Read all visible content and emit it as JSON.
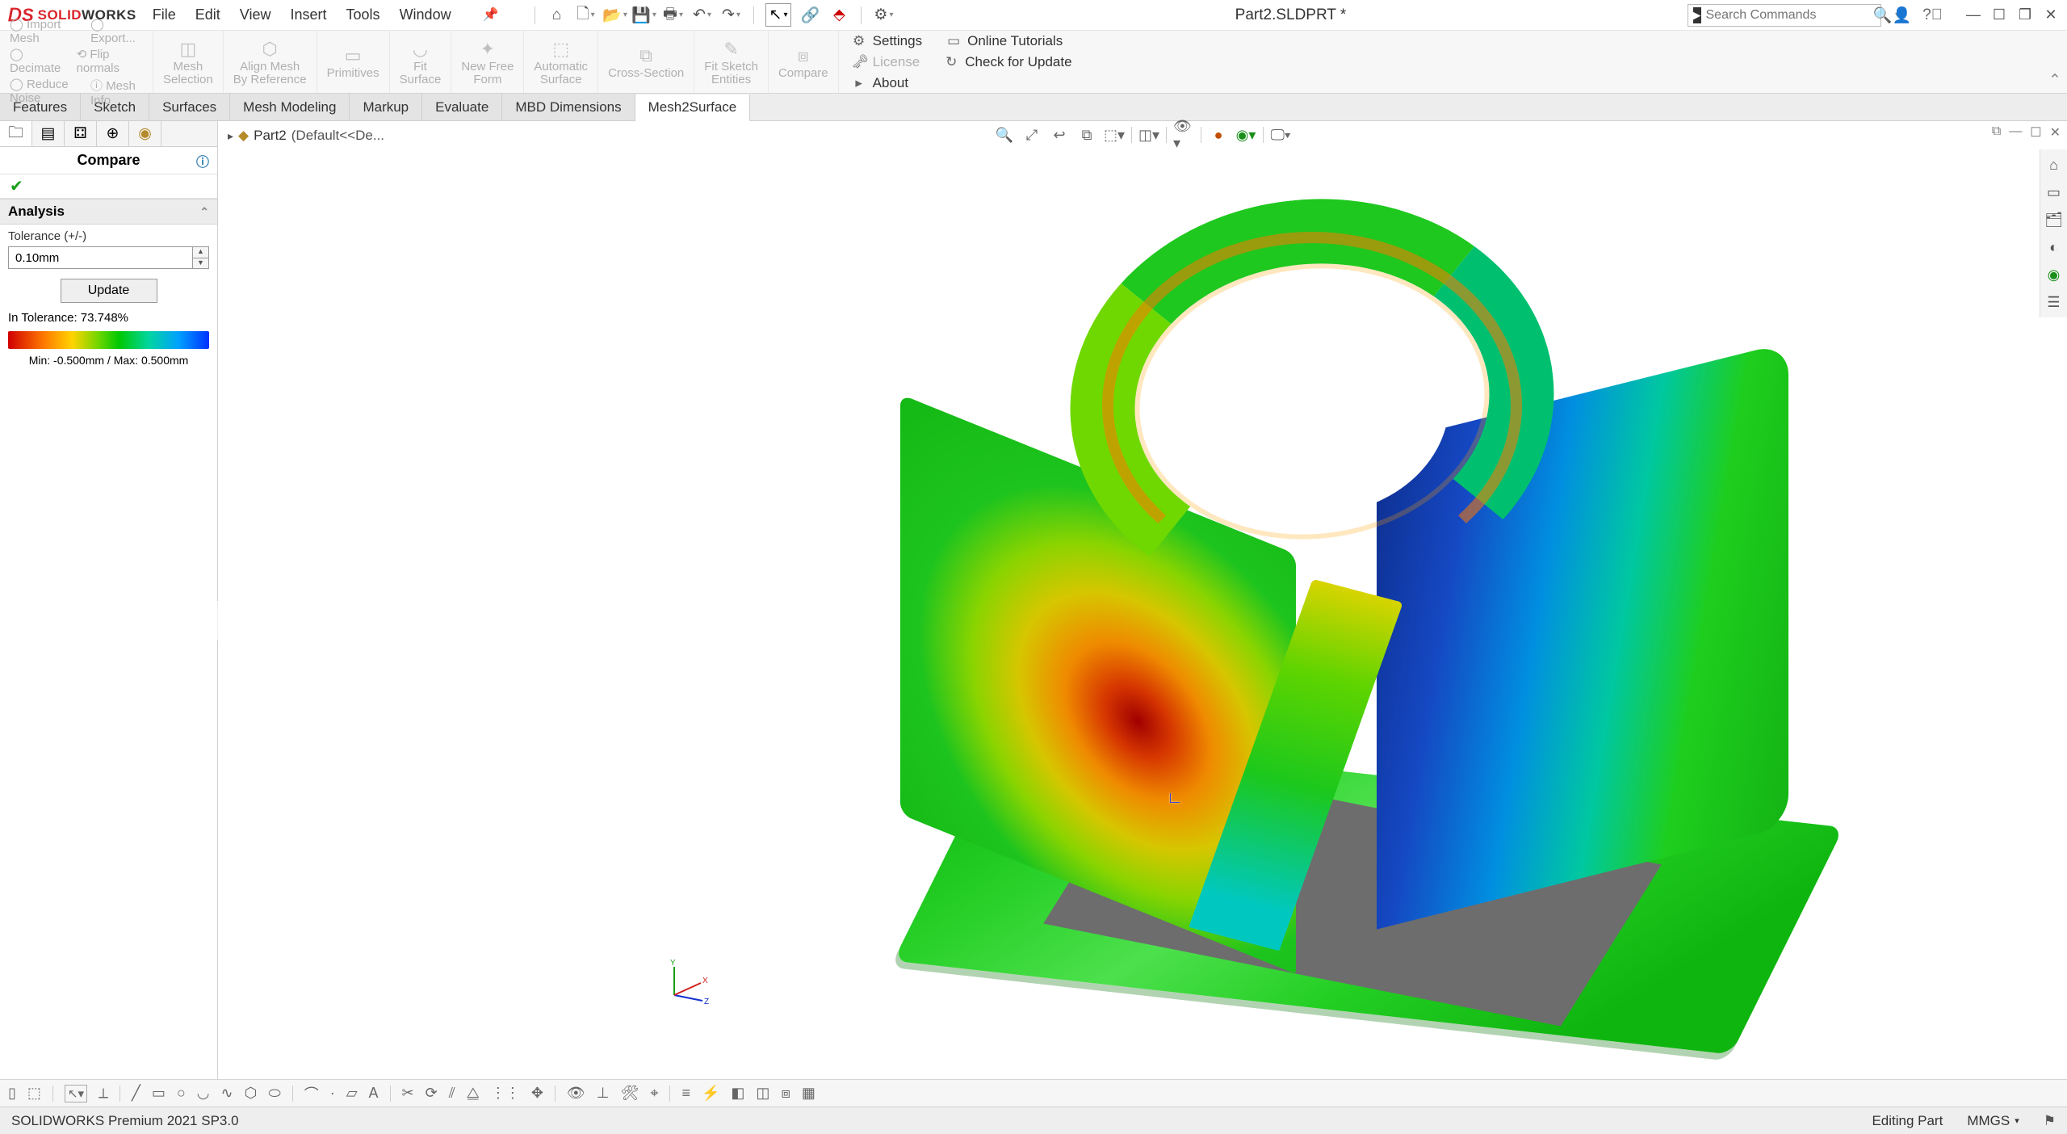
{
  "app": {
    "brand_prefix": "SOLID",
    "brand_suffix": "WORKS",
    "title": "Part2.SLDPRT *",
    "menus": [
      "File",
      "Edit",
      "View",
      "Insert",
      "Tools",
      "Window"
    ]
  },
  "search": {
    "placeholder": "Search Commands"
  },
  "ribbon": {
    "groups": [
      {
        "id": "import-mesh",
        "label": "Import Mesh"
      },
      {
        "id": "export",
        "label": "Export..."
      },
      {
        "id": "decimate",
        "label": "Decimate"
      },
      {
        "id": "flip-normals",
        "label": "Flip normals"
      },
      {
        "id": "reduce-noise",
        "label": "Reduce Noise"
      },
      {
        "id": "mesh-info",
        "label": "Mesh Info"
      },
      {
        "id": "mesh-selection",
        "label": "Mesh\nSelection"
      },
      {
        "id": "align-mesh",
        "label": "Align Mesh\nBy Reference"
      },
      {
        "id": "primitives",
        "label": "Primitives"
      },
      {
        "id": "fit-surface",
        "label": "Fit\nSurface"
      },
      {
        "id": "new-free-form",
        "label": "New Free\nForm"
      },
      {
        "id": "automatic-surface",
        "label": "Automatic\nSurface"
      },
      {
        "id": "cross-section",
        "label": "Cross-Section"
      },
      {
        "id": "fit-sketch-entities",
        "label": "Fit Sketch\nEntities"
      },
      {
        "id": "compare",
        "label": "Compare"
      }
    ],
    "right": [
      {
        "id": "settings",
        "label": "Settings",
        "icon": "⚙"
      },
      {
        "id": "license",
        "label": "License",
        "icon": "🗝"
      },
      {
        "id": "online-tutorials",
        "label": "Online Tutorials",
        "icon": "▭"
      },
      {
        "id": "check-update",
        "label": "Check for Update",
        "icon": "↻"
      },
      {
        "id": "about",
        "label": "About",
        "icon": "▸"
      }
    ]
  },
  "tabs": [
    "Features",
    "Sketch",
    "Surfaces",
    "Mesh Modeling",
    "Markup",
    "Evaluate",
    "MBD Dimensions",
    "Mesh2Surface"
  ],
  "activeTab": "Mesh2Surface",
  "panel": {
    "title": "Compare",
    "section": "Analysis",
    "tol_label": "Tolerance (+/-)",
    "tol_value": "0.10mm",
    "update": "Update",
    "in_tol": "In Tolerance: 73.748%",
    "minmax": "Min: -0.500mm / Max: 0.500mm"
  },
  "breadcrumb": {
    "part": "Part2",
    "config": "(Default<<De..."
  },
  "status": {
    "left": "SOLIDWORKS Premium 2021 SP3.0",
    "mode": "Editing Part",
    "units": "MMGS"
  }
}
